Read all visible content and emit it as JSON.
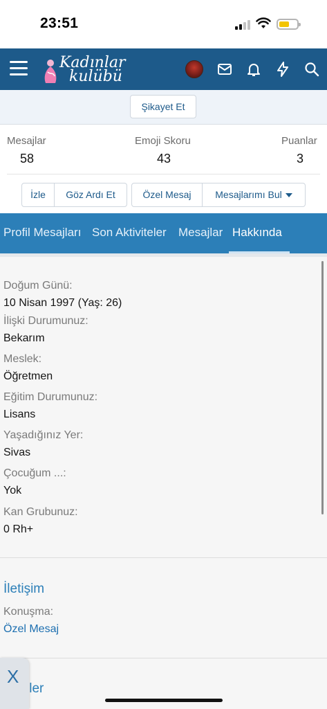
{
  "status_bar": {
    "time": "23:51"
  },
  "header": {
    "logo_line1": "Kadınlar",
    "logo_line2": "kulübü"
  },
  "profile": {
    "report_button": "Şikayet Et",
    "stats": [
      {
        "label": "Mesajlar",
        "value": "58"
      },
      {
        "label": "Emoji Skoru",
        "value": "43"
      },
      {
        "label": "Puanlar",
        "value": "3"
      }
    ],
    "actions": {
      "follow": "İzle",
      "ignore": "Göz Ardı Et",
      "private_message": "Özel Mesaj",
      "find_messages": "Mesajlarımı Bul"
    }
  },
  "tabs": [
    {
      "label": "Profil Mesajları",
      "active": false
    },
    {
      "label": "Son Aktiviteler",
      "active": false
    },
    {
      "label": "Mesajlar",
      "active": false
    },
    {
      "label": "Hakkında",
      "active": true
    }
  ],
  "about": {
    "fields": [
      {
        "label": "Doğum Günü:",
        "value": "10 Nisan 1997 (Yaş: 26)"
      },
      {
        "label": "İlişki Durumunuz:",
        "value": "Bekarım"
      },
      {
        "label": "Meslek:",
        "value": "Öğretmen"
      },
      {
        "label": "Eğitim Durumunuz:",
        "value": "Lisans"
      },
      {
        "label": "Yaşadığınız Yer:",
        "value": "Sivas"
      },
      {
        "label": "Çocuğum ...:",
        "value": "Yok"
      },
      {
        "label": "Kan Grubunuz:",
        "value": "0 Rh+"
      }
    ]
  },
  "contact": {
    "title": "İletişim",
    "label": "Konuşma:",
    "link": "Özel Mesaj"
  },
  "bottom": {
    "close_label": "X",
    "partial_title": "ller"
  },
  "colors": {
    "header_bg": "#1d5a8a",
    "tabs_bg": "#2c7fb8",
    "link": "#1d6fb0"
  }
}
